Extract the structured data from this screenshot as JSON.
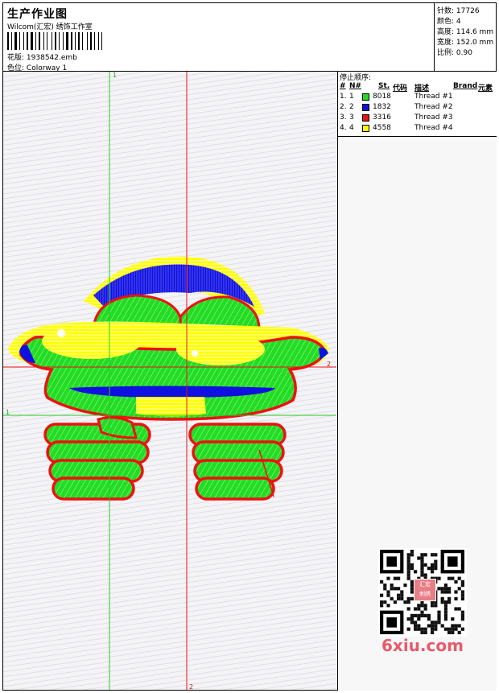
{
  "header": {
    "title": "生产作业图",
    "company": "Wilcom(汇宏) 绣饰工作室",
    "design_label": "花版:",
    "design_file": "1938542.emb",
    "colorway_label": "色位:",
    "colorway": "Colorway 1"
  },
  "stats": {
    "stitches_label": "针数:",
    "stitches": "17726",
    "colors_label": "颜色:",
    "colors": "4",
    "height_label": "高度:",
    "height": "114.6 mm",
    "width_label": "宽度:",
    "width": "152.0 mm",
    "scale_label": "比例:",
    "scale": "0.90"
  },
  "threads": {
    "stop_sequence_label": "停止顺序:",
    "columns": {
      "index": "#",
      "n": "N#",
      "st": "St.",
      "code": "代码",
      "desc": "描述",
      "brand": "Brand",
      "element": "元素"
    },
    "rows": [
      {
        "index": "1.",
        "n": "1",
        "code": "8018",
        "desc": "Thread #1",
        "color": "#22dd22"
      },
      {
        "index": "2.",
        "n": "2",
        "code": "1832",
        "desc": "Thread #2",
        "color": "#1010e0"
      },
      {
        "index": "3.",
        "n": "3",
        "code": "3316",
        "desc": "Thread #3",
        "color": "#ee1111"
      },
      {
        "index": "4.",
        "n": "4",
        "code": "4558",
        "desc": "Thread #4",
        "color": "#ffff00"
      }
    ]
  },
  "guides": {
    "label_v1": "1",
    "label_h1": "1",
    "label_v2": "2",
    "label_h2": "2"
  },
  "watermark": {
    "text": "6xiu.com",
    "seal": "汇宏刺绣"
  },
  "colors": {
    "green": "#22dd22",
    "blue": "#1010e0",
    "red": "#ee1111",
    "yellow": "#ffff00"
  }
}
